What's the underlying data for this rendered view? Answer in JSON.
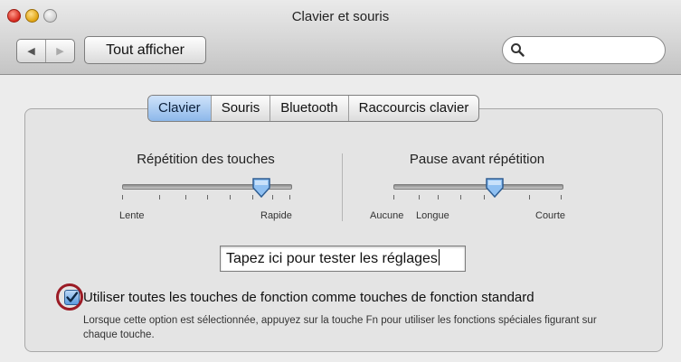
{
  "window": {
    "title": "Clavier et souris"
  },
  "toolbar": {
    "back_glyph": "◀",
    "forward_glyph": "▶",
    "show_all_label": "Tout afficher",
    "search": {
      "value": "",
      "placeholder": ""
    }
  },
  "tabs": [
    {
      "label": "Clavier",
      "selected": true
    },
    {
      "label": "Souris",
      "selected": false
    },
    {
      "label": "Bluetooth",
      "selected": false
    },
    {
      "label": "Raccourcis clavier",
      "selected": false
    }
  ],
  "key_repeat": {
    "title": "Répétition des touches",
    "min_label": "Lente",
    "max_label": "Rapide",
    "value_fraction": 0.83
  },
  "delay": {
    "title": "Pause avant répétition",
    "min_label": "Aucune",
    "mid_label": "Longue",
    "max_label": "Courte",
    "value_fraction": 0.6
  },
  "test_field": {
    "value": "Tapez ici pour tester les réglages"
  },
  "fn_keys": {
    "checked": true,
    "label": "Utiliser toutes les touches de fonction comme touches de fonction standard",
    "help": "Lorsque cette option est sélectionnée, appuyez sur la touche Fn pour utiliser les fonctions spéciales figurant sur chaque touche."
  },
  "colors": {
    "accent": "#5c9be0",
    "annotation_circle": "#9b1b25",
    "window_bg": "#ececec"
  },
  "icons": {
    "search": "search-icon",
    "checkmark": "checkmark-icon",
    "close": "close-window-icon",
    "minimize": "minimize-window-icon",
    "zoom": "zoom-window-icon"
  }
}
